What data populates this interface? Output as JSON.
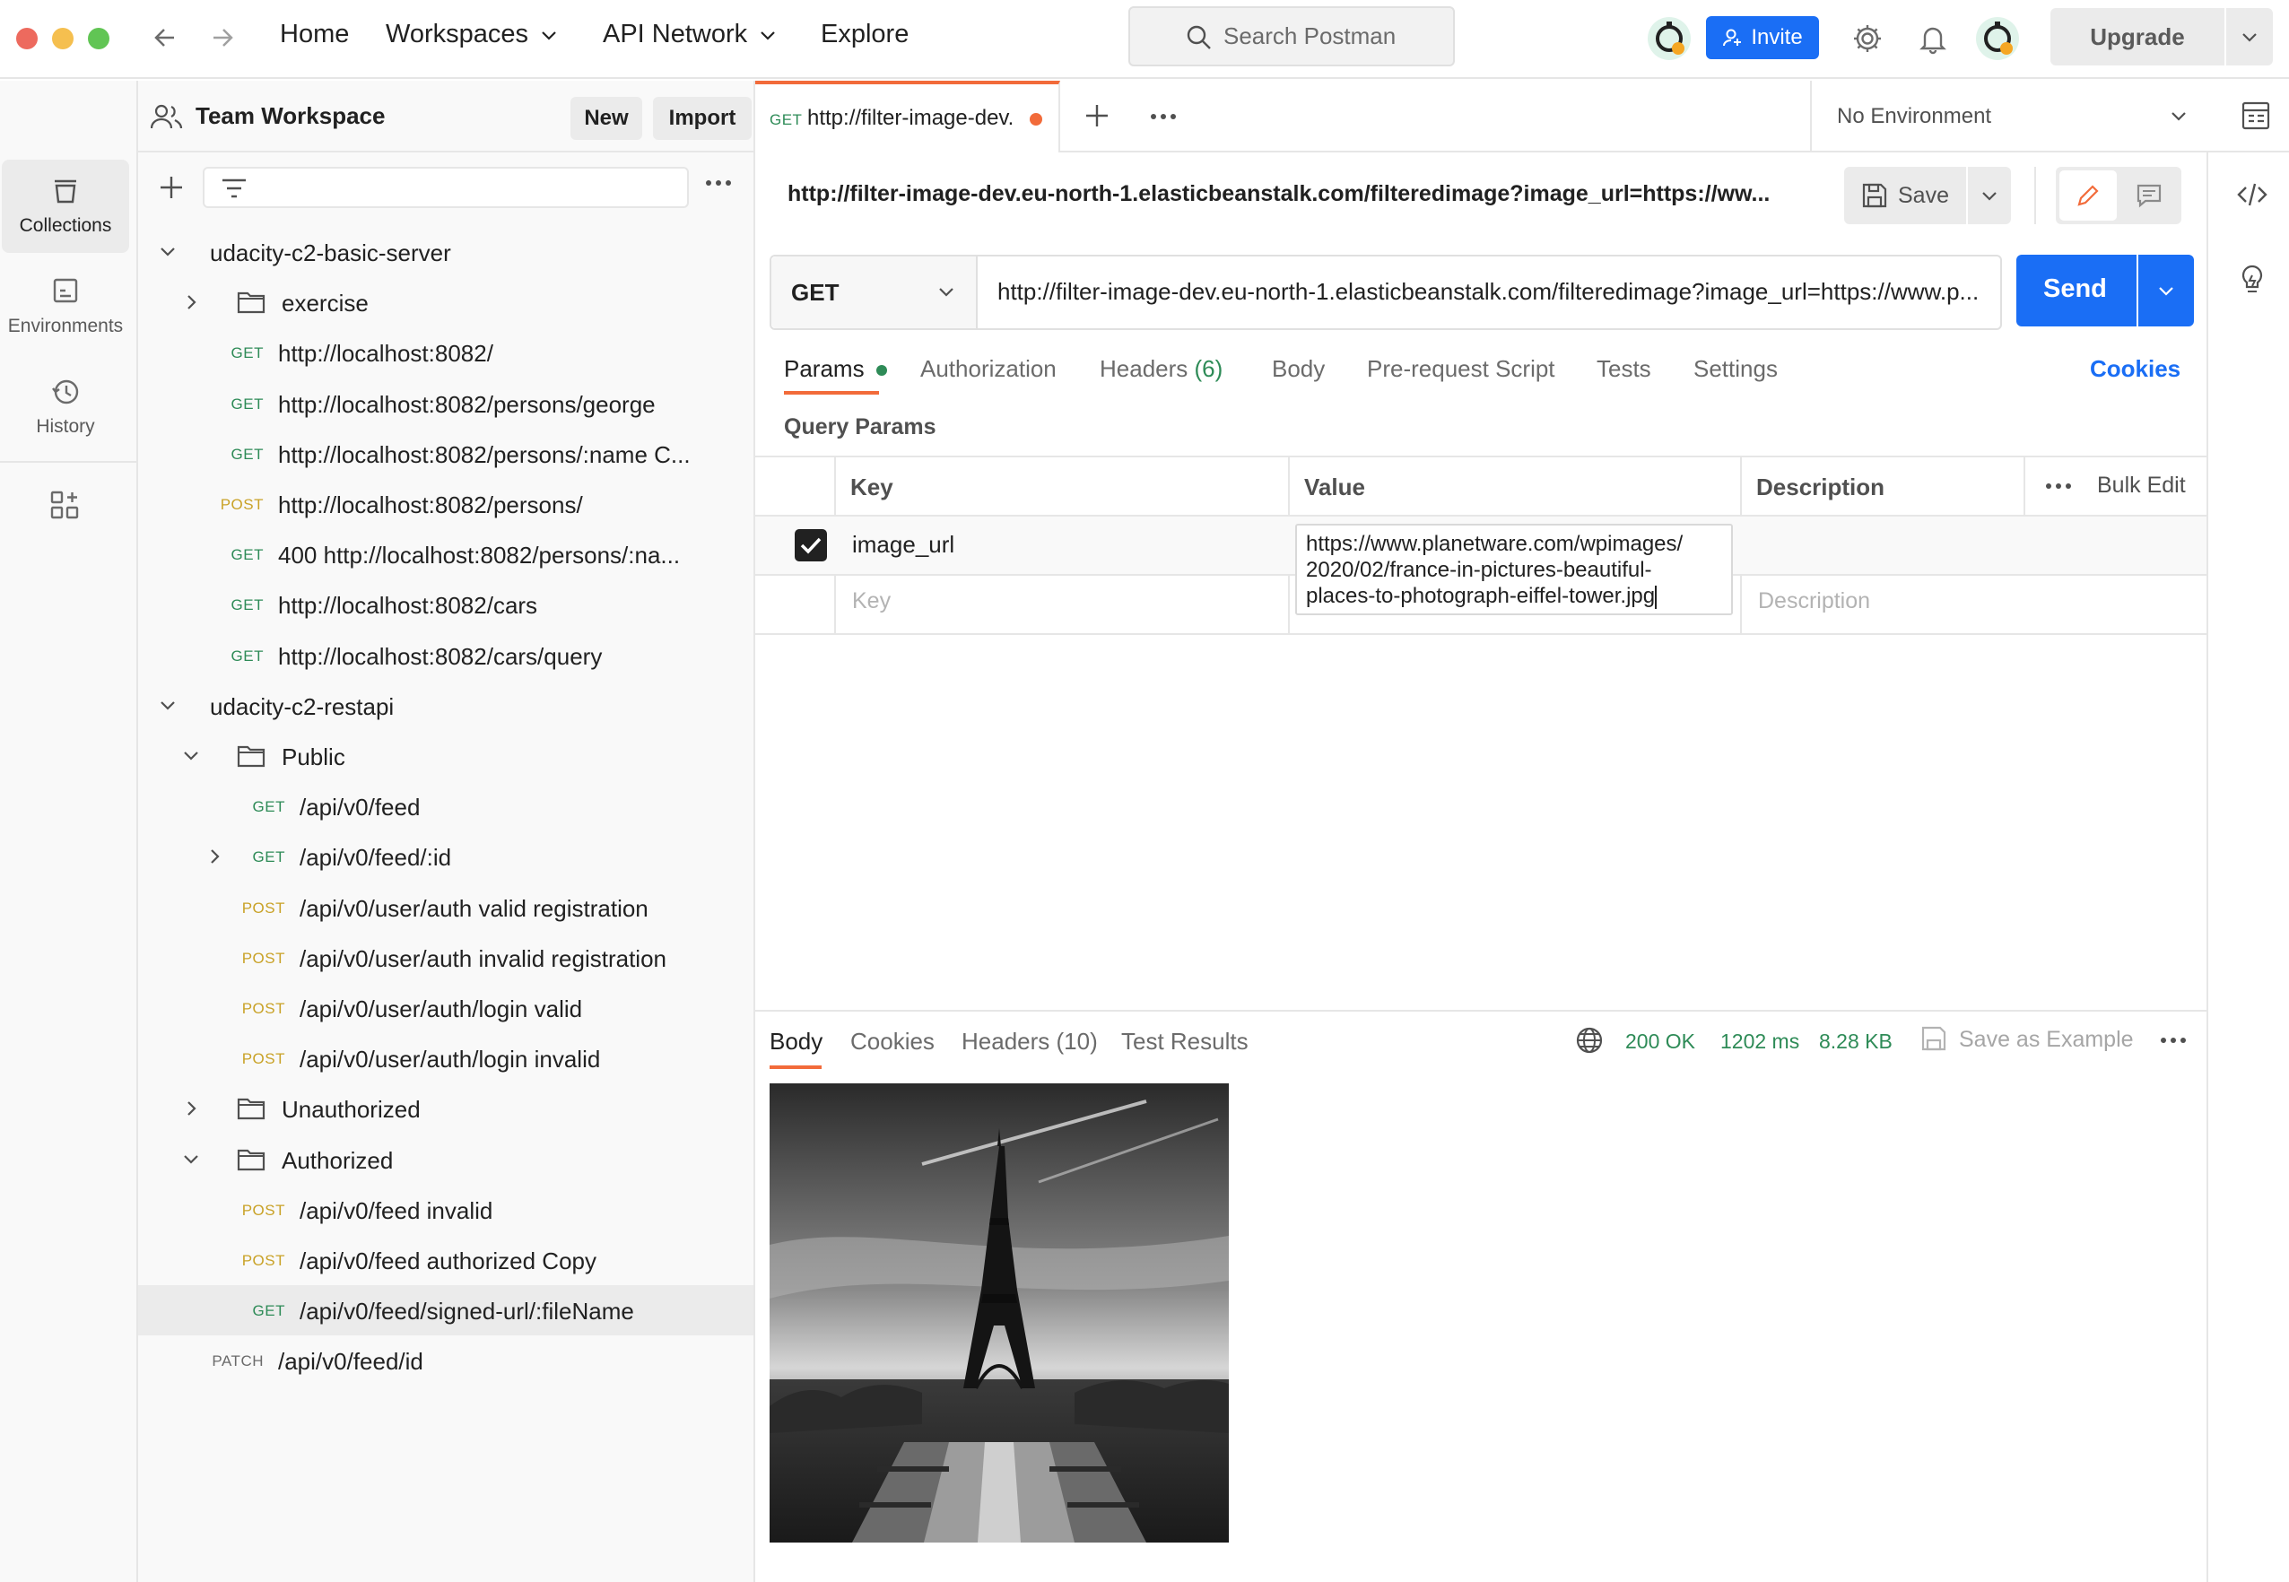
{
  "topbar": {
    "nav": {
      "home": "Home",
      "workspaces": "Workspaces",
      "api_network": "API Network",
      "explore": "Explore"
    },
    "search_placeholder": "Search Postman",
    "invite_label": "Invite",
    "upgrade_label": "Upgrade"
  },
  "rail": {
    "items": [
      {
        "label": "Collections",
        "icon": "collections-icon"
      },
      {
        "label": "Environments",
        "icon": "environments-icon"
      },
      {
        "label": "History",
        "icon": "history-icon"
      }
    ]
  },
  "sidebar": {
    "workspace_name": "Team Workspace",
    "new_label": "New",
    "import_label": "Import",
    "tree": [
      {
        "indent": 0,
        "chevron": "down",
        "kind": "collection",
        "label": "udacity-c2-basic-server"
      },
      {
        "indent": 1,
        "chevron": "right",
        "kind": "folder",
        "label": "exercise"
      },
      {
        "indent": 1,
        "kind": "request",
        "method": "GET",
        "label": "http://localhost:8082/"
      },
      {
        "indent": 1,
        "kind": "request",
        "method": "GET",
        "label": "http://localhost:8082/persons/george"
      },
      {
        "indent": 1,
        "kind": "request",
        "method": "GET",
        "label": "http://localhost:8082/persons/:name C..."
      },
      {
        "indent": 1,
        "kind": "request",
        "method": "POST",
        "label": "http://localhost:8082/persons/"
      },
      {
        "indent": 1,
        "kind": "request",
        "method": "GET",
        "label": "400 http://localhost:8082/persons/:na..."
      },
      {
        "indent": 1,
        "kind": "request",
        "method": "GET",
        "label": "http://localhost:8082/cars"
      },
      {
        "indent": 1,
        "kind": "request",
        "method": "GET",
        "label": "http://localhost:8082/cars/query"
      },
      {
        "indent": 0,
        "chevron": "down",
        "kind": "collection",
        "label": "udacity-c2-restapi"
      },
      {
        "indent": 1,
        "chevron": "down",
        "kind": "folder",
        "label": "Public"
      },
      {
        "indent": 2,
        "kind": "request",
        "method": "GET",
        "label": "/api/v0/feed"
      },
      {
        "indent": 2,
        "chevron": "right",
        "kind": "request",
        "method": "GET",
        "label": "/api/v0/feed/:id"
      },
      {
        "indent": 2,
        "kind": "request",
        "method": "POST",
        "label": "/api/v0/user/auth valid registration"
      },
      {
        "indent": 2,
        "kind": "request",
        "method": "POST",
        "label": "/api/v0/user/auth invalid registration"
      },
      {
        "indent": 2,
        "kind": "request",
        "method": "POST",
        "label": "/api/v0/user/auth/login valid"
      },
      {
        "indent": 2,
        "kind": "request",
        "method": "POST",
        "label": "/api/v0/user/auth/login invalid"
      },
      {
        "indent": 1,
        "chevron": "right",
        "kind": "folder",
        "label": "Unauthorized"
      },
      {
        "indent": 1,
        "chevron": "down",
        "kind": "folder",
        "label": "Authorized"
      },
      {
        "indent": 2,
        "kind": "request",
        "method": "POST",
        "label": "/api/v0/feed invalid"
      },
      {
        "indent": 2,
        "kind": "request",
        "method": "POST",
        "label": "/api/v0/feed authorized Copy"
      },
      {
        "indent": 2,
        "kind": "request",
        "method": "GET",
        "label": "/api/v0/feed/signed-url/:fileName",
        "selected": true
      },
      {
        "indent": 1,
        "kind": "request",
        "method": "PATCH",
        "label": "/api/v0/feed/id"
      }
    ]
  },
  "tab": {
    "method": "GET",
    "title": "http://filter-image-dev."
  },
  "environment": {
    "selected": "No Environment"
  },
  "request": {
    "name": "http://filter-image-dev.eu-north-1.elasticbeanstalk.com/filteredimage?image_url=https://ww...",
    "save_label": "Save",
    "method": "GET",
    "url": "http://filter-image-dev.eu-north-1.elasticbeanstalk.com/filteredimage?image_url=https://www.p...",
    "send_label": "Send"
  },
  "request_tabs": {
    "params": "Params",
    "authorization": "Authorization",
    "headers": "Headers",
    "headers_count": "(6)",
    "body": "Body",
    "pre_request": "Pre-request Script",
    "tests": "Tests",
    "settings": "Settings",
    "cookies": "Cookies"
  },
  "query_params": {
    "title": "Query Params",
    "headers": {
      "key": "Key",
      "value": "Value",
      "description": "Description",
      "bulk_edit": "Bulk Edit"
    },
    "rows": [
      {
        "checked": true,
        "key": "image_url",
        "value_lines": [
          "https://www.planetware.com/wpimages/",
          "2020/02/france-in-pictures-beautiful-",
          "places-to-photograph-eiffel-tower.jpg"
        ]
      }
    ],
    "placeholder_key": "Key",
    "placeholder_description": "Description"
  },
  "response": {
    "tabs": {
      "body": "Body",
      "cookies": "Cookies",
      "headers": "Headers",
      "headers_count": "(10)",
      "test_results": "Test Results"
    },
    "status": "200 OK",
    "time": "1202 ms",
    "size": "8.28 KB",
    "save_example": "Save as Example"
  },
  "colors": {
    "accent_orange": "#f26b3a",
    "send_blue": "#1a6ef5",
    "status_green": "#2e8b57",
    "method_get": "#2e8b57",
    "method_post": "#c9a227"
  }
}
